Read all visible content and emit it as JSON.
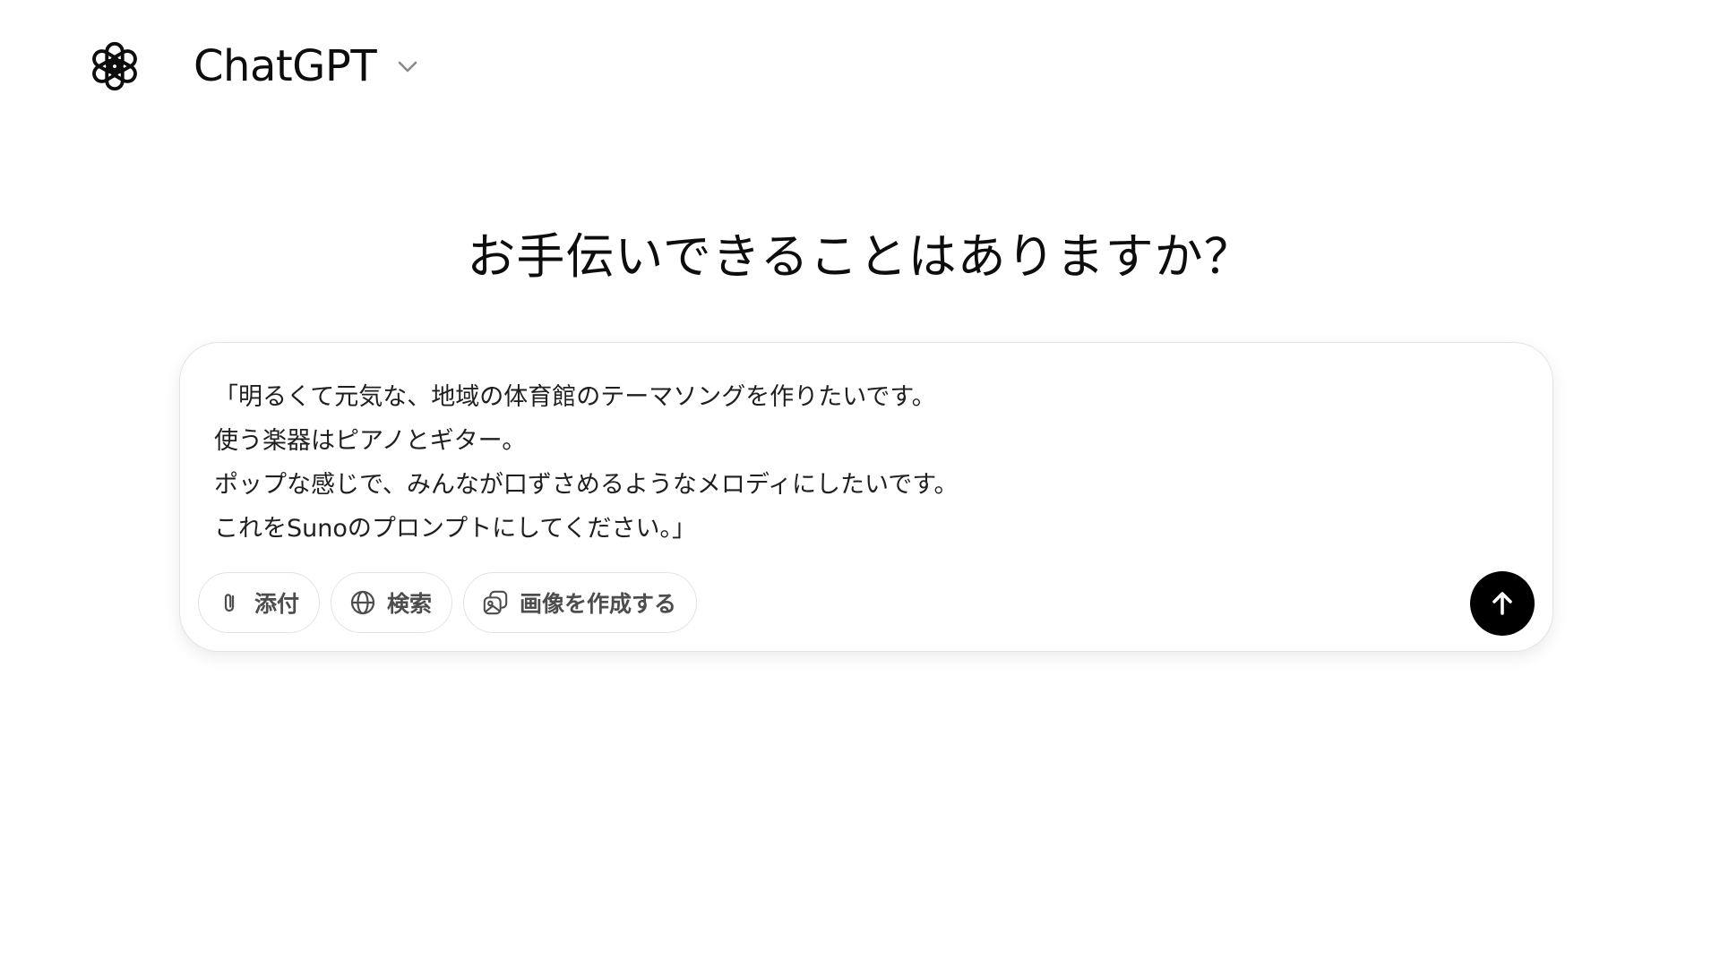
{
  "header": {
    "logo_icon": "openai-logo-icon",
    "model_name": "ChatGPT",
    "dropdown_icon": "chevron-down-icon"
  },
  "main": {
    "headline": "お手伝いできることはありますか？"
  },
  "composer": {
    "prompt_lines": [
      "「明るくて元気な、地域の体育館のテーマソングを作りたいです。",
      "使う楽器はピアノとギター。",
      "ポップな感じで、みんなが口ずさめるようなメロディにしたいです。",
      "これをSunoのプロンプトにしてください。」"
    ],
    "tools": [
      {
        "label": "添付",
        "icon": "paperclip-icon"
      },
      {
        "label": "検索",
        "icon": "globe-icon"
      },
      {
        "label": "画像を作成する",
        "icon": "image-create-icon"
      }
    ],
    "send_icon": "arrow-up-icon"
  },
  "colors": {
    "text": "#0d0d0d",
    "border": "#e3e3e3",
    "send_button": "#000000",
    "tool_text": "#4d4d4d"
  }
}
